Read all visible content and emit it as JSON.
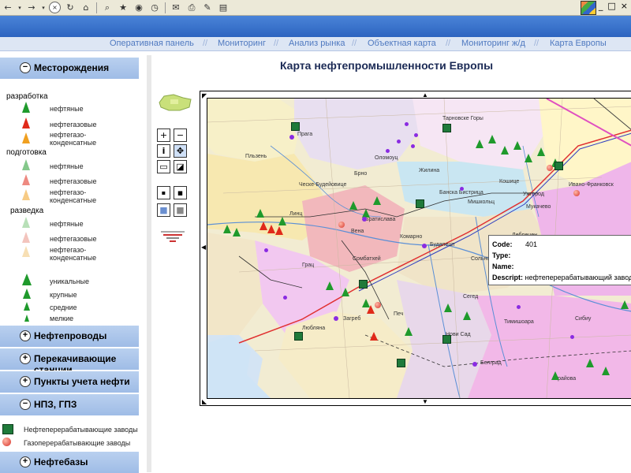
{
  "nav": {
    "items": [
      "Оперативная панель",
      "Мониторинг",
      "Анализ рынка",
      "Объектная карта",
      "Мониторинг ж/д",
      "Карта Европы"
    ]
  },
  "sidebar": {
    "header_main": "Месторождения",
    "groups": {
      "development": "разработка",
      "preparation": "подготовка",
      "exploration": "разведка"
    },
    "types": {
      "oil": "нефтяные",
      "oilgas": "нефтегазовые",
      "condensate": "нефтегазо-\nконденсатные"
    },
    "sizes": [
      "уникальные",
      "крупные",
      "средние",
      "мелкие"
    ],
    "sections": [
      "Нефтепроводы",
      "Перекачивающие станции",
      "Пункты учета нефти",
      "НПЗ, ГПЗ"
    ],
    "refinery_legend": [
      "Нефтеперерабатывающие заводы",
      "Газоперерабатывающие заводы"
    ],
    "last_section": "Нефтебазы"
  },
  "main": {
    "title": "Карта нефтепромышленности Европы"
  },
  "map": {
    "labels": [
      "Прага",
      "Пльзень",
      "Брно",
      "Оломоуц",
      "Жилина",
      "Линц",
      "Братислава",
      "Вена",
      "Будапешт",
      "Грац",
      "Загреб",
      "Любляна",
      "Белград",
      "Кошице",
      "Мишкольц",
      "Сегед",
      "Нови Сад",
      "Тимишоара",
      "Сибиу",
      "Крайова",
      "Банска Бистрица",
      "Ивано-Франковск",
      "Ужгород",
      "Мукачево",
      "Дебрецен",
      "Сольнок",
      "Печ",
      "Сомбатхей",
      "Комарно",
      "Ческе-Будейовице",
      "Тарновске Горы"
    ],
    "popup": {
      "code_label": "Code:",
      "code_value": "401",
      "type_label": "Type:",
      "name_label": "Name:",
      "descript_label": "Descript:",
      "descript_value": "нефтеперерабатывающий завод"
    }
  },
  "colors": {
    "header_blue": "#2d64c0",
    "nav_text": "#4f79c0",
    "sidebar_head": "#b0c8ec",
    "oil_green": "#1f9a2c",
    "gas_red": "#e02a1a",
    "cond_orange": "#f0a020"
  }
}
